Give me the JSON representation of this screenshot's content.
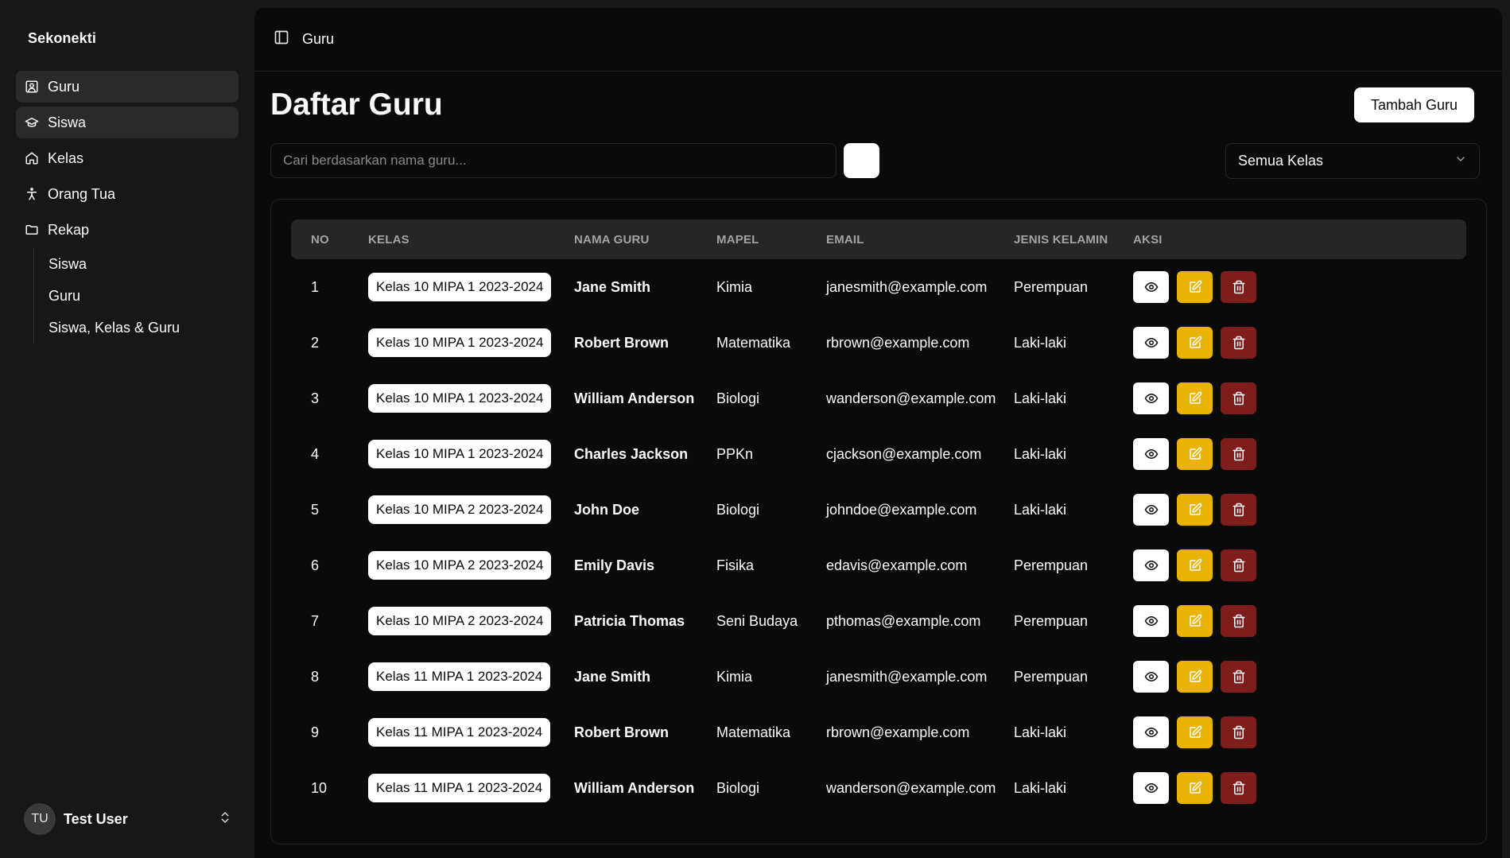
{
  "sidebar": {
    "brand": "Sekonekti",
    "items": [
      {
        "label": "Guru",
        "icon": "user-square-icon",
        "active": true
      },
      {
        "label": "Siswa",
        "icon": "graduation-cap-icon",
        "active": true
      },
      {
        "label": "Kelas",
        "icon": "home-icon",
        "active": false
      },
      {
        "label": "Orang Tua",
        "icon": "person-icon",
        "active": false
      },
      {
        "label": "Rekap",
        "icon": "folder-icon",
        "active": false
      }
    ],
    "subitems": [
      {
        "label": "Siswa"
      },
      {
        "label": "Guru"
      },
      {
        "label": "Siswa, Kelas & Guru"
      }
    ],
    "user": {
      "initials": "TU",
      "name": "Test User"
    }
  },
  "header": {
    "breadcrumb": "Guru"
  },
  "page": {
    "title": "Daftar Guru",
    "add_button": "Tambah Guru",
    "search": {
      "placeholder": "Cari berdasarkan nama guru..."
    },
    "filter": {
      "selected": "Semua Kelas"
    }
  },
  "table": {
    "columns": [
      "NO",
      "KELAS",
      "NAMA GURU",
      "MAPEL",
      "EMAIL",
      "JENIS KELAMIN",
      "AKSI"
    ],
    "rows": [
      {
        "no": "1",
        "kelas": "Kelas 10 MIPA 1 2023-2024",
        "nama": "Jane Smith",
        "mapel": "Kimia",
        "email": "janesmith@example.com",
        "jk": "Perempuan"
      },
      {
        "no": "2",
        "kelas": "Kelas 10 MIPA 1 2023-2024",
        "nama": "Robert Brown",
        "mapel": "Matematika",
        "email": "rbrown@example.com",
        "jk": "Laki-laki"
      },
      {
        "no": "3",
        "kelas": "Kelas 10 MIPA 1 2023-2024",
        "nama": "William Anderson",
        "mapel": "Biologi",
        "email": "wanderson@example.com",
        "jk": "Laki-laki"
      },
      {
        "no": "4",
        "kelas": "Kelas 10 MIPA 1 2023-2024",
        "nama": "Charles Jackson",
        "mapel": "PPKn",
        "email": "cjackson@example.com",
        "jk": "Laki-laki"
      },
      {
        "no": "5",
        "kelas": "Kelas 10 MIPA 2 2023-2024",
        "nama": "John Doe",
        "mapel": "Biologi",
        "email": "johndoe@example.com",
        "jk": "Laki-laki"
      },
      {
        "no": "6",
        "kelas": "Kelas 10 MIPA 2 2023-2024",
        "nama": "Emily Davis",
        "mapel": "Fisika",
        "email": "edavis@example.com",
        "jk": "Perempuan"
      },
      {
        "no": "7",
        "kelas": "Kelas 10 MIPA 2 2023-2024",
        "nama": "Patricia Thomas",
        "mapel": "Seni Budaya",
        "email": "pthomas@example.com",
        "jk": "Perempuan"
      },
      {
        "no": "8",
        "kelas": "Kelas 11 MIPA 1 2023-2024",
        "nama": "Jane Smith",
        "mapel": "Kimia",
        "email": "janesmith@example.com",
        "jk": "Perempuan"
      },
      {
        "no": "9",
        "kelas": "Kelas 11 MIPA 1 2023-2024",
        "nama": "Robert Brown",
        "mapel": "Matematika",
        "email": "rbrown@example.com",
        "jk": "Laki-laki"
      },
      {
        "no": "10",
        "kelas": "Kelas 11 MIPA 1 2023-2024",
        "nama": "William Anderson",
        "mapel": "Biologi",
        "email": "wanderson@example.com",
        "jk": "Laki-laki"
      }
    ]
  },
  "colors": {
    "edit": "#eab308",
    "delete": "#7f1d1d",
    "background": "#0a0a0a",
    "sidebar": "#171717"
  }
}
